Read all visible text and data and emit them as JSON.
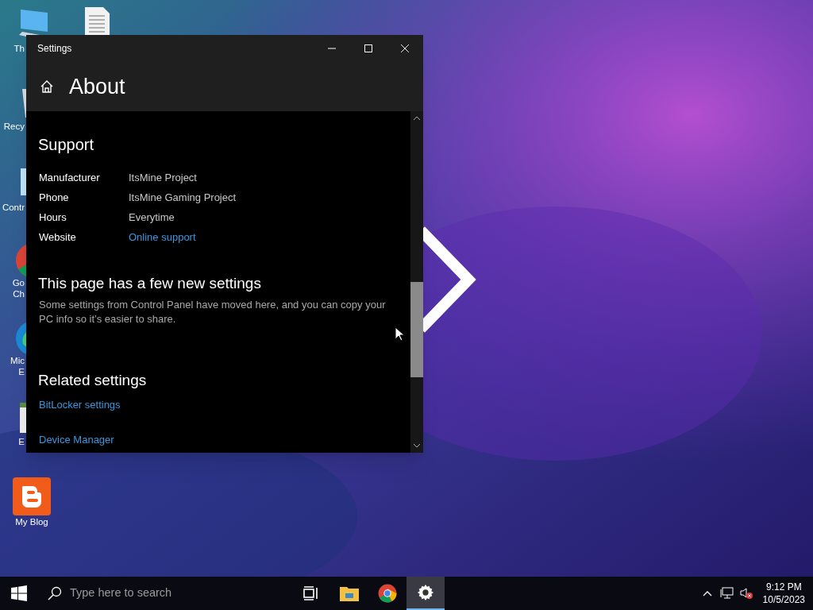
{
  "desktop_icons": [
    {
      "kind": "computer",
      "label_lines": [
        "Th"
      ]
    },
    {
      "kind": "document"
    },
    {
      "kind": "recycle",
      "label_lines": [
        "Recy"
      ]
    },
    {
      "kind": "control",
      "label_lines": [
        "Contr"
      ]
    },
    {
      "kind": "chrome",
      "label_lines": [
        "Go",
        "Ch"
      ]
    },
    {
      "kind": "edge",
      "label_lines": [
        "Mic",
        "E"
      ]
    },
    {
      "kind": "app",
      "label_lines": [
        "E"
      ]
    },
    {
      "kind": "blog",
      "label_lines": [
        "My Blog"
      ]
    }
  ],
  "window": {
    "title": "Settings",
    "page_title": "About",
    "support": {
      "heading": "Support",
      "rows": [
        {
          "label": "Manufacturer",
          "value": "ItsMine Project",
          "kind": "text"
        },
        {
          "label": "Phone",
          "value": "ItsMine Gaming Project",
          "kind": "text"
        },
        {
          "label": "Hours",
          "value": "Everytime",
          "kind": "text"
        },
        {
          "label": "Website",
          "value": "Online support",
          "kind": "link"
        }
      ]
    },
    "new_settings": {
      "heading": "This page has a few new settings",
      "body": "Some settings from Control Panel have moved here, and you can copy your PC info so it’s easier to share."
    },
    "related": {
      "heading": "Related settings",
      "links": [
        "BitLocker settings",
        "Device Manager"
      ]
    }
  },
  "taskbar": {
    "search": {
      "placeholder": "Type here to search"
    },
    "apps": [
      {
        "kind": "taskview",
        "selected": false
      },
      {
        "kind": "explorer",
        "selected": false
      },
      {
        "kind": "chrome",
        "selected": false
      },
      {
        "kind": "settings",
        "selected": true
      }
    ],
    "time": "9:12 PM",
    "date": "10/5/2023"
  }
}
